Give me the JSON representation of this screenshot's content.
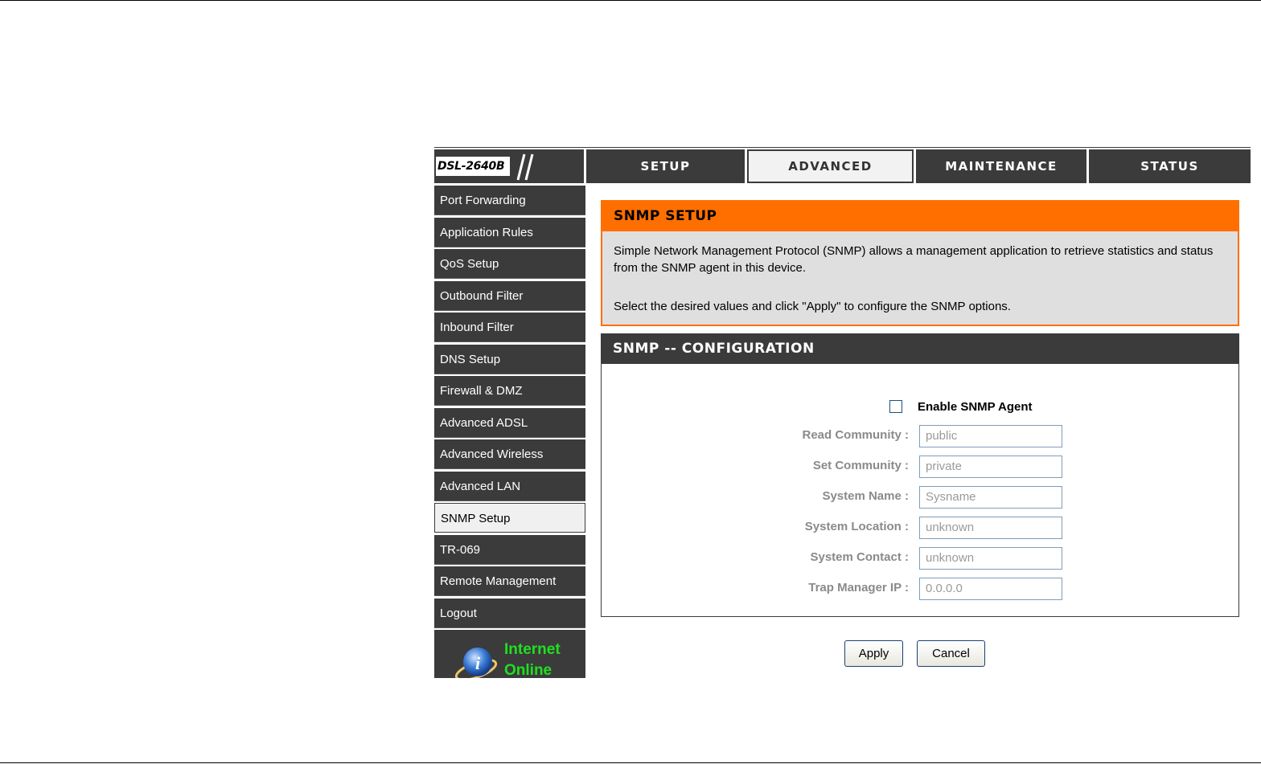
{
  "header": {
    "model": "DSL-2640B",
    "tabs": [
      {
        "label": "SETUP",
        "active": false
      },
      {
        "label": "ADVANCED",
        "active": true
      },
      {
        "label": "MAINTENANCE",
        "active": false
      },
      {
        "label": "STATUS",
        "active": false
      }
    ]
  },
  "sidebar": {
    "items": [
      {
        "label": "Port Forwarding"
      },
      {
        "label": "Application Rules"
      },
      {
        "label": "QoS Setup"
      },
      {
        "label": "Outbound Filter"
      },
      {
        "label": "Inbound Filter"
      },
      {
        "label": "DNS Setup"
      },
      {
        "label": "Firewall & DMZ"
      },
      {
        "label": "Advanced ADSL"
      },
      {
        "label": "Advanced Wireless"
      },
      {
        "label": "Advanced LAN"
      },
      {
        "label": "SNMP Setup",
        "active": true
      },
      {
        "label": "TR-069"
      },
      {
        "label": "Remote Management"
      },
      {
        "label": "Logout"
      }
    ],
    "status": {
      "line1": "Internet",
      "line2": "Online",
      "color": "#1fe01f"
    }
  },
  "intro": {
    "title": "SNMP SETUP",
    "paragraph1": "Simple Network Management Protocol (SNMP) allows a management application to retrieve statistics and status from the SNMP agent in this device.",
    "paragraph2": "Select the desired values and click \"Apply\" to configure the SNMP options."
  },
  "config": {
    "title": "SNMP -- CONFIGURATION",
    "enable_label": "Enable SNMP Agent",
    "enable_checked": false,
    "fields": [
      {
        "label": "Read Community :",
        "value": "public"
      },
      {
        "label": "Set Community :",
        "value": "private"
      },
      {
        "label": "System Name :",
        "value": "Sysname"
      },
      {
        "label": "System Location :",
        "value": "unknown"
      },
      {
        "label": "System Contact :",
        "value": "unknown"
      },
      {
        "label": "Trap Manager IP :",
        "value": "0.0.0.0"
      }
    ]
  },
  "buttons": {
    "apply": "Apply",
    "cancel": "Cancel"
  },
  "colors": {
    "accent": "#ff6f00",
    "dark": "#3b3b3b",
    "intro_bg": "#dfdfdf"
  }
}
